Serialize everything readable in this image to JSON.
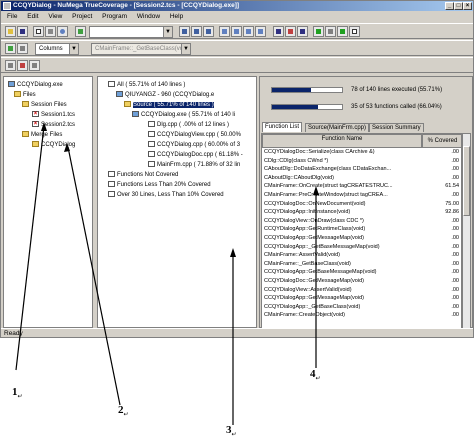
{
  "window": {
    "title": "CCQYDialog - NuMega TrueCoverage - [Session2.tcs - [CCQYDialog.exe]]",
    "min_glyph": "_",
    "max_glyph": "□",
    "close_glyph": "×"
  },
  "menu": [
    "File",
    "Edit",
    "View",
    "Project",
    "Program",
    "Window",
    "Help"
  ],
  "toolbar2": {
    "columns_label": "Columns",
    "function_combo": "CMainFrame::_GetBaseClass(void)"
  },
  "left_tree": {
    "root": "CCQYDialog.exe",
    "files": "Files",
    "session_files": "Session Files",
    "session1": "Session1.tcs",
    "session2": "Session2.tcs",
    "merge_files": "Merge Files",
    "merge_item": "CCQYDialog"
  },
  "middle_tree": {
    "all": "All ( 55.71% of 140 lines )",
    "machine": "QIUYANGZ - 960 (CCQYDialog.e",
    "source": "Source ( 55.71% of 140 lines )",
    "exe": "CCQYDialog.exe ( 55.71% of 140 li",
    "files": [
      "Dlg.cpp ( .00% of 12 lines )",
      "CCQYDialogView.cpp ( 50.00%",
      "CCQYDialog.cpp ( 60.00% of 3",
      "CCQYDialogDoc.cpp ( 61.18% -",
      "MainFrm.cpp ( 71.88% of 32 lin"
    ],
    "filters": [
      "Functions Not Covered",
      "Functions Less Than 20% Covered",
      "Over 30 Lines, Less Than 10% Covered"
    ]
  },
  "summary": {
    "lines_text": "78 of 140 lines executed (55.71%)",
    "lines_fraction": 0.5571,
    "funcs_text": "35 of 53 functions called (66.04%)",
    "funcs_fraction": 0.6604
  },
  "tabs": [
    "Function List",
    "Source(MainFrm.cpp)",
    "Session Summary"
  ],
  "table": {
    "col_function": "Function Name",
    "col_covered": "% Covered",
    "rows": [
      {
        "fn": "CCQYDialogDoc::Serialize(class CArchive &)",
        "pc": ".00"
      },
      {
        "fn": "CDlg::CDlg(class CWnd *)",
        "pc": ".00"
      },
      {
        "fn": "CAboutDlg::DoDataExchange(class CDataExchan...",
        "pc": ".00"
      },
      {
        "fn": "CAboutDlg::CAboutDlg(void)",
        "pc": ".00"
      },
      {
        "fn": "CMainFrame::OnCreate(struct tagCREATESTRUC...",
        "pc": "61.54"
      },
      {
        "fn": "CMainFrame::PreCreateWindow(struct tagCREA...",
        "pc": ".00"
      },
      {
        "fn": "CCQYDialogDoc::OnNewDocument(void)",
        "pc": "75.00"
      },
      {
        "fn": "CCQYDialogApp::InitInstance(void)",
        "pc": "92.86"
      },
      {
        "fn": "CCQYDialogView::OnDraw(class CDC *)",
        "pc": ".00"
      },
      {
        "fn": "CCQYDialogApp::GetRuntimeClass(void)",
        "pc": ".00"
      },
      {
        "fn": "CCQYDialogApp::GetMessageMap(void)",
        "pc": ".00"
      },
      {
        "fn": "CCQYDialogApp::_GetBaseMessageMap(void)",
        "pc": ".00"
      },
      {
        "fn": "CMainFrame::AssertValid(void)",
        "pc": ".00"
      },
      {
        "fn": "CMainFrame::_GetBaseClass(void)",
        "pc": ".00"
      },
      {
        "fn": "CCQYDialogApp::GetBaseMessageMap(void)",
        "pc": ".00"
      },
      {
        "fn": "CCQYDialogDoc::GetMessageMap(void)",
        "pc": ".00"
      },
      {
        "fn": "CCQYDialogView::AssertValid(void)",
        "pc": ".00"
      },
      {
        "fn": "CCQYDialogApp::GetMessageMap(void)",
        "pc": ".00"
      },
      {
        "fn": "CCQYDialogApp::_GetBaseClass(void)",
        "pc": ".00"
      },
      {
        "fn": "CMainFrame::CreateObject(void)",
        "pc": ".00"
      }
    ]
  },
  "status": "Ready",
  "callouts": {
    "c1": "1",
    "c2": "2",
    "c3": "3",
    "c4": "4",
    "mark": "↵"
  }
}
